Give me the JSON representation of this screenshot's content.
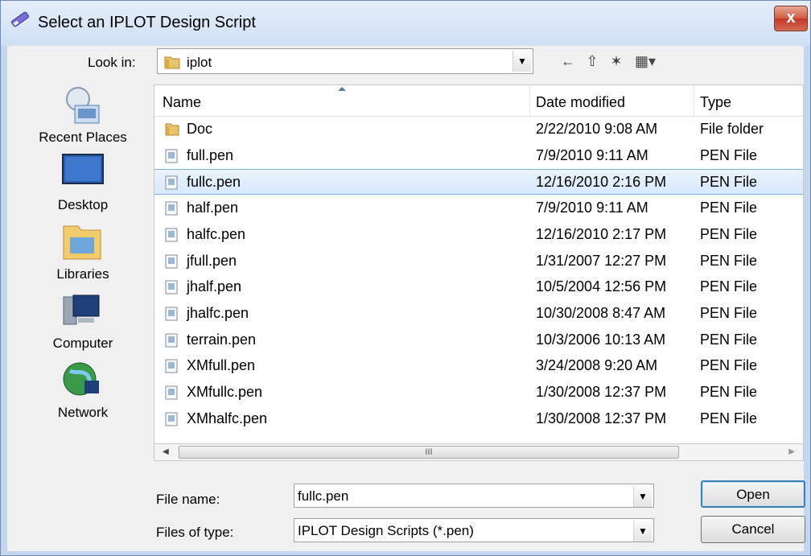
{
  "window": {
    "title": "Select an IPLOT Design Script",
    "close_label": "x"
  },
  "look_in": {
    "label": "Look in:",
    "value": "iplot"
  },
  "toolbar": {
    "back": "←",
    "up": "⇧",
    "new_folder": "✶",
    "view": "▦▾"
  },
  "places": [
    {
      "label": "Recent Places",
      "icon": "recent-places-icon"
    },
    {
      "label": "Desktop",
      "icon": "desktop-icon"
    },
    {
      "label": "Libraries",
      "icon": "libraries-icon"
    },
    {
      "label": "Computer",
      "icon": "computer-icon"
    },
    {
      "label": "Network",
      "icon": "network-icon"
    }
  ],
  "columns": {
    "name": "Name",
    "date": "Date modified",
    "type": "Type"
  },
  "files": [
    {
      "name": "Doc",
      "date": "2/22/2010 9:08 AM",
      "type": "File folder",
      "kind": "folder"
    },
    {
      "name": "full.pen",
      "date": "7/9/2010 9:11 AM",
      "type": "PEN File",
      "kind": "file"
    },
    {
      "name": "fullc.pen",
      "date": "12/16/2010 2:16 PM",
      "type": "PEN File",
      "kind": "file",
      "selected": true
    },
    {
      "name": "half.pen",
      "date": "7/9/2010 9:11 AM",
      "type": "PEN File",
      "kind": "file"
    },
    {
      "name": "halfc.pen",
      "date": "12/16/2010 2:17 PM",
      "type": "PEN File",
      "kind": "file"
    },
    {
      "name": "jfull.pen",
      "date": "1/31/2007 12:27 PM",
      "type": "PEN File",
      "kind": "file"
    },
    {
      "name": "jhalf.pen",
      "date": "10/5/2004 12:56 PM",
      "type": "PEN File",
      "kind": "file"
    },
    {
      "name": "jhalfc.pen",
      "date": "10/30/2008 8:47 AM",
      "type": "PEN File",
      "kind": "file"
    },
    {
      "name": "terrain.pen",
      "date": "10/3/2006 10:13 AM",
      "type": "PEN File",
      "kind": "file"
    },
    {
      "name": "XMfull.pen",
      "date": "3/24/2008 9:20 AM",
      "type": "PEN File",
      "kind": "file"
    },
    {
      "name": "XMfullc.pen",
      "date": "1/30/2008 12:37 PM",
      "type": "PEN File",
      "kind": "file"
    },
    {
      "name": "XMhalfc.pen",
      "date": "1/30/2008 12:37 PM",
      "type": "PEN File",
      "kind": "file"
    }
  ],
  "scrollbar": {
    "grip": "III"
  },
  "file_name": {
    "label": "File name:",
    "value": "fullc.pen"
  },
  "file_type": {
    "label": "Files of type:",
    "value": "IPLOT Design Scripts (*.pen)"
  },
  "buttons": {
    "open": "Open",
    "cancel": "Cancel"
  }
}
